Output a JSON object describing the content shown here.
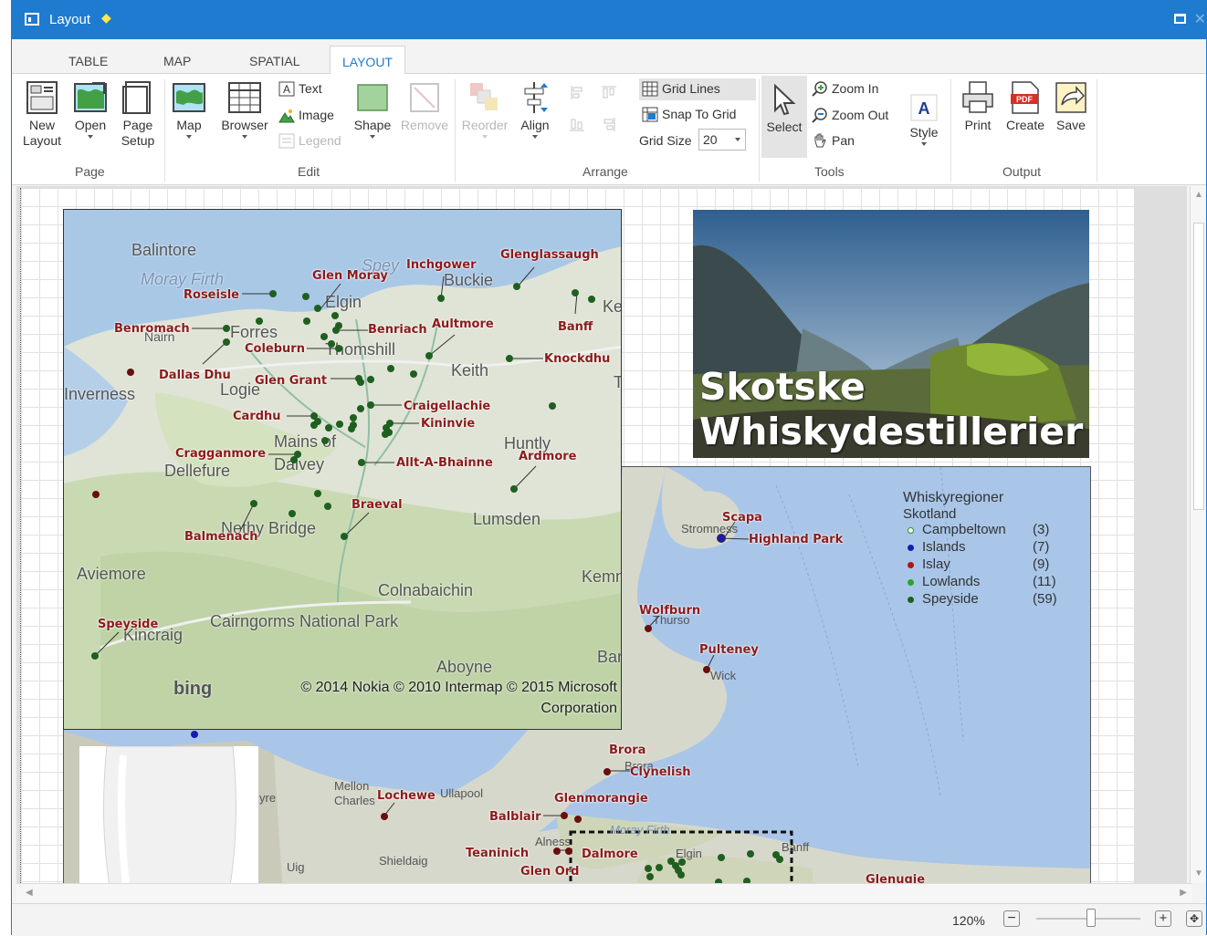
{
  "window": {
    "title": "Layout"
  },
  "tabs": [
    "TABLE",
    "MAP",
    "SPATIAL",
    "LAYOUT"
  ],
  "ribbon": {
    "page": {
      "new_layout": "New\nLayout",
      "open": "Open",
      "page_setup": "Page\nSetup",
      "group": "Page"
    },
    "edit": {
      "map": "Map",
      "browser": "Browser",
      "text": "Text",
      "image": "Image",
      "legend": "Legend",
      "shape": "Shape",
      "remove": "Remove",
      "group": "Edit"
    },
    "arrange": {
      "reorder": "Reorder",
      "align": "Align",
      "grid_lines": "Grid Lines",
      "snap_to_grid": "Snap To Grid",
      "grid_size_label": "Grid Size",
      "grid_size_value": "20",
      "group": "Arrange"
    },
    "tools": {
      "select": "Select",
      "zoom_in": "Zoom In",
      "zoom_out": "Zoom Out",
      "pan": "Pan",
      "style": "Style",
      "group": "Tools"
    },
    "output": {
      "print": "Print",
      "create": "Create",
      "save": "Save",
      "group": "Output"
    }
  },
  "banner": {
    "title_line1": "Skotske",
    "title_line2": "Whiskydestillerier"
  },
  "legend": {
    "title": "Whiskyregioner",
    "subtitle": "Skotland",
    "items": [
      {
        "name": "Campbeltown",
        "count": "(3)",
        "color": "#2f8f2f",
        "hollow": true
      },
      {
        "name": "Islands",
        "count": "(7)",
        "color": "#1a1ab0"
      },
      {
        "name": "Islay",
        "count": "(9)",
        "color": "#b31313"
      },
      {
        "name": "Lowlands",
        "count": "(11)",
        "color": "#2aa52a"
      },
      {
        "name": "Speyside",
        "count": "(59)",
        "color": "#1f5f1f"
      }
    ]
  },
  "map1": {
    "places": [
      "Balintore",
      "Moray Firth",
      "Spey",
      "Buckie",
      "Elgin",
      "Forres",
      "Nairn",
      "Thomshill",
      "Keith",
      "Logie",
      "Inverness",
      "Mains of",
      "Dalvey",
      "Dellefure",
      "Huntly",
      "Lumsden",
      "Nethy Bridge",
      "Aviemore",
      "Colnabaichin",
      "Kincraig",
      "Cairngorms National Park",
      "Aboyne",
      "Kemn",
      "Bar",
      "Ke",
      "T",
      "Nairn"
    ],
    "distilleries": [
      "Glenglassaugh",
      "Inchgower",
      "Glen Moray",
      "Roseisle",
      "Benromach",
      "Benriach",
      "Aultmore",
      "Banff",
      "Coleburn",
      "Knockdhu",
      "Dallas Dhu",
      "Glen Grant",
      "Craigellachie",
      "Cardhu",
      "Kininvie",
      "Cragganmore",
      "Allt-A-Bhainne",
      "Ardmore",
      "Braeval",
      "Balmenach",
      "Speyside"
    ],
    "copyright": "© 2014 Nokia © 2010 Intermap © 2015 Microsoft Corporation",
    "logo": "bing"
  },
  "map2": {
    "places": [
      "Stromness",
      "Thurso",
      "Wick",
      "Mellon Charles",
      "Ullapool",
      "Shieldaig",
      "Uig",
      "Alness",
      "Moray Firth",
      "Elgin",
      "Banff",
      "Brora",
      "yre"
    ],
    "distilleries": [
      "Scapa",
      "Highland Park",
      "Wolfburn",
      "Pulteney",
      "Brora",
      "Clynelish",
      "Glenmorangie",
      "Lochewe",
      "Balblair",
      "Teaninich",
      "Dalmore",
      "Glen Ord",
      "Glenugie"
    ]
  },
  "status": {
    "zoom": "120%"
  },
  "colors": {
    "accent": "#1e7bd0",
    "label_red": "#8b1b1b",
    "speyside_dot": "#1f5f1f"
  }
}
